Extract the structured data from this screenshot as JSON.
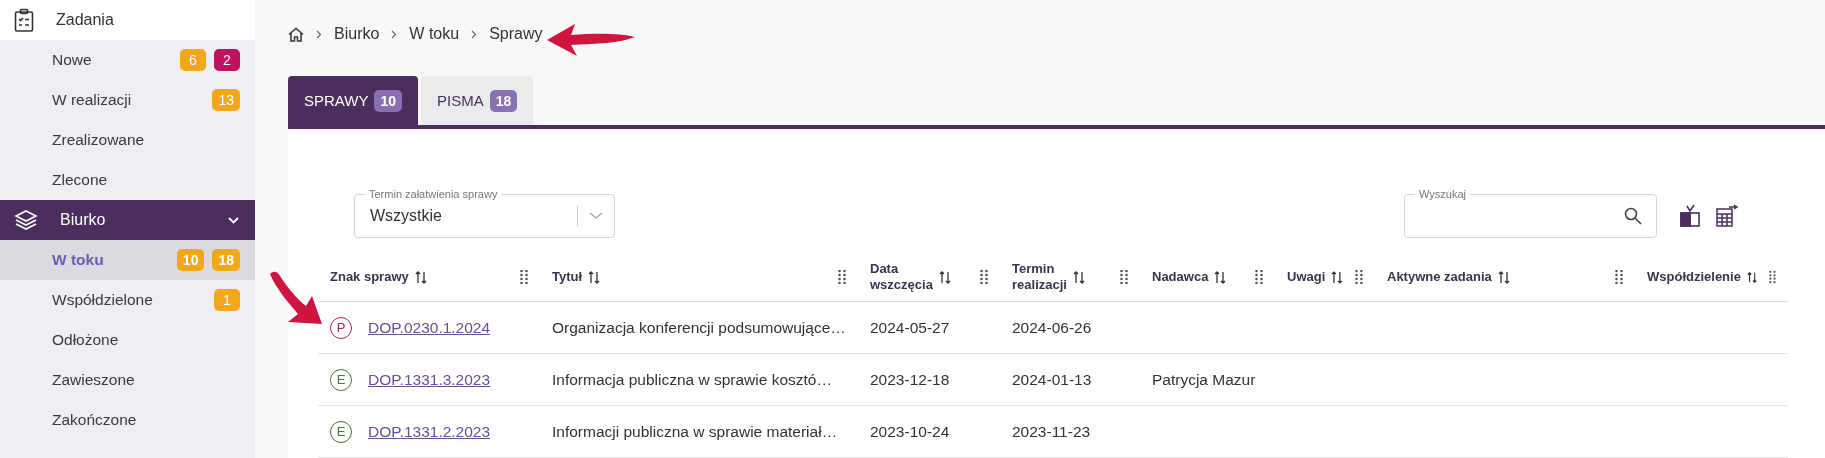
{
  "sidebar": {
    "sections": [
      {
        "label": "Zadania",
        "selected": false,
        "expanded": false,
        "children": [
          {
            "label": "Nowe",
            "selected": false,
            "badges": [
              {
                "text": "6",
                "color": "#f2a71b"
              },
              {
                "text": "2",
                "color": "#c0125f"
              }
            ]
          },
          {
            "label": "W realizacji",
            "selected": false,
            "badges": [
              {
                "text": "13",
                "color": "#f2a71b"
              }
            ]
          },
          {
            "label": "Zrealizowane",
            "selected": false
          },
          {
            "label": "Zlecone",
            "selected": false
          }
        ]
      },
      {
        "label": "Biurko",
        "selected": true,
        "expanded": true,
        "children": [
          {
            "label": "W toku",
            "selected": true,
            "badges": [
              {
                "text": "10",
                "color": "#f2a71b"
              },
              {
                "text": "18",
                "color": "#f2a71b"
              }
            ]
          },
          {
            "label": "Współdzielone",
            "selected": false,
            "badges": [
              {
                "text": "1",
                "color": "#f2a71b"
              }
            ]
          },
          {
            "label": "Odłożone",
            "selected": false
          },
          {
            "label": "Zawieszone",
            "selected": false
          },
          {
            "label": "Zakończone",
            "selected": false
          }
        ]
      }
    ]
  },
  "breadcrumb": [
    "Biurko",
    "W toku",
    "Sprawy"
  ],
  "tabs": [
    {
      "label": "SPRAWY",
      "count": "10",
      "selected": true
    },
    {
      "label": "PISMA",
      "count": "18",
      "selected": false
    }
  ],
  "filter": {
    "label": "Termin załatwienia sprawy",
    "value": "Wszystkie"
  },
  "search": {
    "label": "Wyszukaj"
  },
  "table": {
    "columns": [
      {
        "lines": [
          "Znak sprawy"
        ]
      },
      {
        "lines": [
          "Tytuł"
        ]
      },
      {
        "lines": [
          "Data",
          "wszczęcia"
        ]
      },
      {
        "lines": [
          "Termin",
          "realizacji"
        ]
      },
      {
        "lines": [
          "Nadawca"
        ]
      },
      {
        "lines": [
          "Uwagi"
        ]
      },
      {
        "lines": [
          "Aktywne zadania"
        ]
      },
      {
        "lines": [
          "Współdzielenie"
        ]
      }
    ],
    "rows": [
      {
        "type": "P",
        "color": "#b5253f",
        "sign": "DOP.0230.1.2024",
        "title": "Organizacja konferencji podsumowujące…",
        "started": "2024-05-27",
        "due": "2024-06-26"
      },
      {
        "type": "E",
        "color": "#3e7d32",
        "sign": "DOP.1331.3.2023",
        "title": "Informacja publiczna w sprawie kosztó…",
        "started": "2023-12-18",
        "due": "2024-01-13",
        "sender": "Patrycja Mazur"
      },
      {
        "type": "E",
        "color": "#3e7d32",
        "sign": "DOP.1331.2.2023",
        "title": "Informacji publiczna w sprawie materiał…",
        "started": "2023-10-24",
        "due": "2023-11-23"
      }
    ]
  }
}
